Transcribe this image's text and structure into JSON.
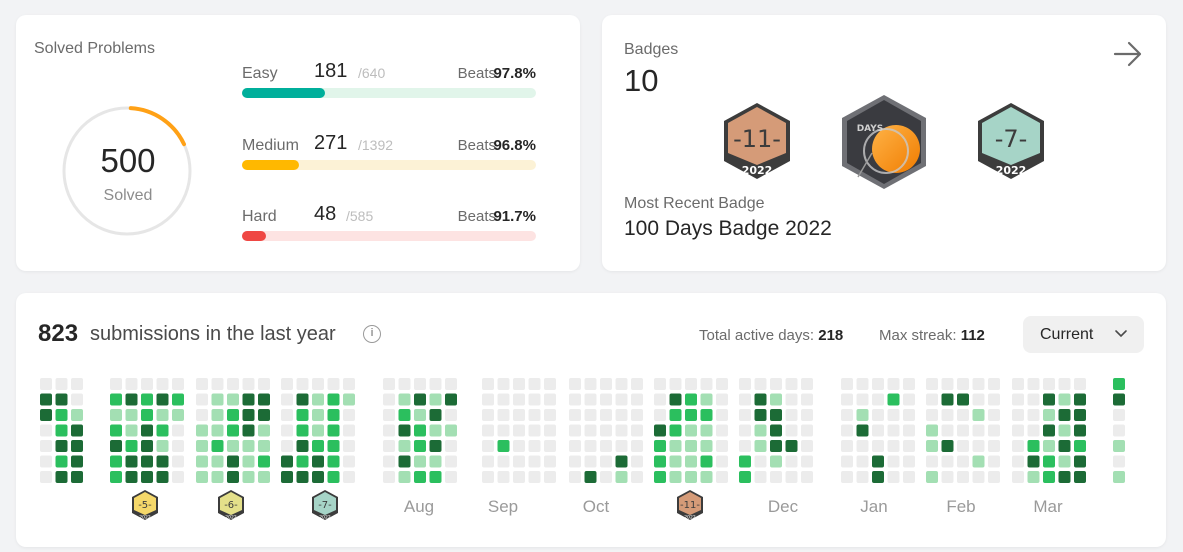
{
  "solved": {
    "title": "Solved Problems",
    "total": "500",
    "total_label": "Solved",
    "progress": 0.18,
    "difficulties": [
      {
        "name": "Easy",
        "solved": "181",
        "total": "/640",
        "beats_label": "Beats",
        "beats": "97.8%",
        "fraction": 0.283,
        "color": "#00af9b",
        "track": "#e1f5ea"
      },
      {
        "name": "Medium",
        "solved": "271",
        "total": "/1392",
        "beats_label": "Beats",
        "beats": "96.8%",
        "fraction": 0.195,
        "color": "#ffb800",
        "track": "#fcf2d6"
      },
      {
        "name": "Hard",
        "solved": "48",
        "total": "/585",
        "beats_label": "Beats",
        "beats": "91.7%",
        "fraction": 0.082,
        "color": "#ef4743",
        "track": "#fde3e2"
      }
    ]
  },
  "badges": {
    "title": "Badges",
    "count": "10",
    "items": [
      {
        "kind": "monthly",
        "number": "11",
        "year": "2022",
        "color": "#d59b78",
        "dark": "#a8715a"
      },
      {
        "kind": "days",
        "label": "DAYS",
        "color": "#3a3b40"
      },
      {
        "kind": "monthly",
        "number": "7",
        "year": "2022",
        "color": "#a6d4c7",
        "dark": "#7aa89c"
      }
    ],
    "recent_label": "Most Recent Badge",
    "recent_name": "100 Days Badge 2022"
  },
  "submissions": {
    "count": "823",
    "text": "submissions in the last year",
    "info_icon": "info-icon",
    "active_label": "Total active days:",
    "active": "218",
    "streak_label": "Max streak:",
    "streak": "112",
    "dropdown": "Current",
    "months": [
      {
        "label": "",
        "cols": [
          [
            0,
            3,
            3,
            0,
            0,
            0,
            0
          ],
          [
            0,
            3,
            2,
            2,
            3,
            2,
            3
          ],
          [
            0,
            0,
            1,
            3,
            3,
            3,
            3
          ]
        ]
      },
      {
        "label": "",
        "cols": [
          [
            0,
            2,
            1,
            2,
            3,
            2,
            2
          ],
          [
            0,
            3,
            1,
            1,
            2,
            3,
            3
          ],
          [
            0,
            2,
            2,
            3,
            3,
            3,
            3
          ],
          [
            0,
            3,
            1,
            2,
            1,
            3,
            3
          ],
          [
            0,
            2,
            1,
            0,
            0,
            0,
            0
          ]
        ]
      },
      {
        "label": "",
        "cols": [
          [
            0,
            0,
            0,
            1,
            1,
            1,
            1
          ],
          [
            0,
            1,
            1,
            1,
            2,
            1,
            1
          ],
          [
            0,
            1,
            2,
            2,
            1,
            3,
            3
          ],
          [
            0,
            3,
            3,
            3,
            1,
            1,
            1
          ],
          [
            0,
            3,
            3,
            1,
            1,
            2,
            1
          ]
        ]
      },
      {
        "label": "",
        "cols": [
          [
            0,
            0,
            0,
            0,
            0,
            3,
            3
          ],
          [
            0,
            3,
            2,
            2,
            3,
            2,
            3
          ],
          [
            0,
            1,
            1,
            1,
            2,
            3,
            3
          ],
          [
            0,
            2,
            2,
            2,
            2,
            2,
            2
          ],
          [
            0,
            1,
            0,
            0,
            0,
            0,
            0
          ]
        ]
      },
      {
        "label": "Aug",
        "cols": [
          [
            0,
            0,
            0,
            0,
            0,
            0,
            0
          ],
          [
            0,
            1,
            2,
            3,
            1,
            3,
            1
          ],
          [
            0,
            3,
            1,
            2,
            2,
            1,
            2
          ],
          [
            0,
            1,
            3,
            1,
            3,
            1,
            2
          ],
          [
            0,
            3,
            0,
            1,
            0,
            0,
            0
          ]
        ]
      },
      {
        "label": "Sep",
        "cols": [
          [
            0,
            0,
            0,
            0,
            0,
            0,
            0
          ],
          [
            0,
            0,
            0,
            0,
            2,
            0,
            0
          ],
          [
            0,
            0,
            0,
            0,
            0,
            0,
            0
          ],
          [
            0,
            0,
            0,
            0,
            0,
            0,
            0
          ],
          [
            0,
            0,
            0,
            0,
            0,
            0,
            0
          ]
        ]
      },
      {
        "label": "Oct",
        "cols": [
          [
            0,
            0,
            0,
            0,
            0,
            0,
            0
          ],
          [
            0,
            0,
            0,
            0,
            0,
            0,
            3
          ],
          [
            0,
            0,
            0,
            0,
            0,
            0,
            0
          ],
          [
            0,
            0,
            0,
            0,
            0,
            3,
            1
          ],
          [
            0,
            0,
            0,
            0,
            0,
            0,
            0
          ]
        ]
      },
      {
        "label": "",
        "cols": [
          [
            0,
            0,
            0,
            3,
            2,
            2,
            2
          ],
          [
            0,
            3,
            2,
            2,
            1,
            1,
            1
          ],
          [
            0,
            2,
            2,
            1,
            1,
            1,
            1
          ],
          [
            0,
            1,
            2,
            1,
            1,
            2,
            1
          ],
          [
            0,
            0,
            0,
            0,
            0,
            0,
            0
          ]
        ]
      },
      {
        "label": "Dec",
        "cols": [
          [
            0,
            0,
            0,
            0,
            0,
            2,
            2
          ],
          [
            0,
            3,
            3,
            1,
            1,
            0,
            0
          ],
          [
            0,
            1,
            3,
            3,
            3,
            1,
            0
          ],
          [
            0,
            0,
            0,
            0,
            3,
            0,
            0
          ],
          [
            0,
            0,
            0,
            0,
            0,
            0,
            0
          ]
        ]
      },
      {
        "label": "Jan",
        "cols": [
          [
            0,
            0,
            0,
            0,
            0,
            0,
            0
          ],
          [
            0,
            0,
            1,
            3,
            0,
            0,
            0
          ],
          [
            0,
            0,
            0,
            0,
            0,
            3,
            3
          ],
          [
            0,
            2,
            0,
            0,
            0,
            0,
            0
          ],
          [
            0,
            0,
            0,
            0,
            0,
            0,
            0
          ]
        ]
      },
      {
        "label": "Feb",
        "cols": [
          [
            0,
            0,
            0,
            1,
            1,
            0,
            1
          ],
          [
            0,
            3,
            0,
            0,
            3,
            0,
            0
          ],
          [
            0,
            3,
            0,
            0,
            0,
            0,
            0
          ],
          [
            0,
            0,
            1,
            0,
            0,
            1,
            0
          ],
          [
            0,
            0,
            0,
            0,
            0,
            0,
            0
          ]
        ]
      },
      {
        "label": "Mar",
        "cols": [
          [
            0,
            0,
            0,
            0,
            0,
            0,
            0
          ],
          [
            0,
            0,
            0,
            0,
            2,
            3,
            1
          ],
          [
            0,
            3,
            1,
            3,
            1,
            2,
            2
          ],
          [
            0,
            1,
            3,
            1,
            3,
            1,
            3
          ],
          [
            0,
            3,
            3,
            3,
            2,
            3,
            3
          ]
        ]
      }
    ],
    "last_col": [
      2,
      3,
      0,
      0,
      1,
      0,
      1
    ],
    "mini_badges": [
      {
        "number": "5",
        "year": "2022",
        "color": "#f5d86a",
        "dark": "#c9a93b"
      },
      {
        "number": "6",
        "year": "2022",
        "color": "#e4e08a",
        "dark": "#b6b25b"
      },
      {
        "number": "7",
        "year": "2022",
        "color": "#a6d4c7",
        "dark": "#7aa89c"
      },
      {
        "number": "11",
        "year": "2022",
        "color": "#d59b78",
        "dark": "#a8715a"
      }
    ],
    "level_colors": [
      "#ececec",
      "#a3dfb3",
      "#2bbf5e",
      "#1c6b36"
    ]
  }
}
